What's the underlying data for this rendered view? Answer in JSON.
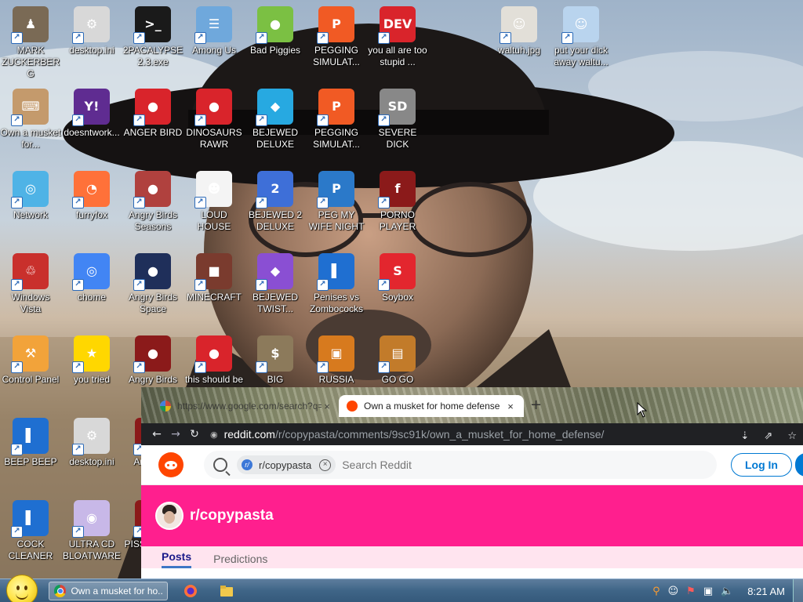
{
  "desktop": {
    "icons": [
      {
        "label": "MARK ZUCKERBERG",
        "color": "#7a6a55",
        "glyph": "♟"
      },
      {
        "label": "desktop.ini",
        "color": "#d8d8d8",
        "glyph": "⚙"
      },
      {
        "label": "2PACALYPSE 2.3.exe",
        "color": "#1a1a1a",
        "glyph": ">_"
      },
      {
        "label": "Among Us",
        "color": "#6fa8dc",
        "glyph": "☰"
      },
      {
        "label": "Bad Piggies",
        "color": "#7bc043",
        "glyph": "●"
      },
      {
        "label": "PEGGING SIMULAT...",
        "color": "#f15a24",
        "glyph": "P"
      },
      {
        "label": "you all are too stupid ...",
        "color": "#d9242b",
        "glyph": "DEV"
      },
      {
        "label": "waltuh.jpg",
        "color": "#e2dfd8",
        "glyph": "☺"
      },
      {
        "label": "put your dick away waltu...",
        "color": "#b9d4ee",
        "glyph": "☺"
      },
      {
        "label": "Own a musket for...",
        "color": "#c49a6c",
        "glyph": "⌨"
      },
      {
        "label": "doesntwork...",
        "color": "#5f2c91",
        "glyph": "Y!"
      },
      {
        "label": "ANGER BIRD",
        "color": "#d9242b",
        "glyph": "●"
      },
      {
        "label": "DINOSAURS RAWR",
        "color": "#d9242b",
        "glyph": "●"
      },
      {
        "label": "BEJEWED DELUXE",
        "color": "#27a9e1",
        "glyph": "◆"
      },
      {
        "label": "PEGGING SIMULAT...",
        "color": "#f15a24",
        "glyph": "P"
      },
      {
        "label": "SEVERE DICK",
        "color": "#888888",
        "glyph": "SD"
      },
      {
        "label": "Network",
        "color": "#4fb3e6",
        "glyph": "◎"
      },
      {
        "label": "furryfox",
        "color": "#ff7139",
        "glyph": "◔"
      },
      {
        "label": "Angry Birds Seasons",
        "color": "#b0413e",
        "glyph": "●"
      },
      {
        "label": "LOUD HOUSE",
        "color": "#f4f4f4",
        "glyph": "☻"
      },
      {
        "label": "BEJEWED 2 DELUXE",
        "color": "#3e6fd8",
        "glyph": "2"
      },
      {
        "label": "PEG MY WIFE NIGHT",
        "color": "#2b79c9",
        "glyph": "P"
      },
      {
        "label": "PORNO PLAYER",
        "color": "#8b1a1a",
        "glyph": "f"
      },
      {
        "label": "Windows Vista",
        "color": "#c9302c",
        "glyph": "♲"
      },
      {
        "label": "chome",
        "color": "#4285f4",
        "glyph": "◎"
      },
      {
        "label": "Angry Birds Space",
        "color": "#1f2f5a",
        "glyph": "●"
      },
      {
        "label": "MINECRAFT",
        "color": "#7a3b2e",
        "glyph": "■"
      },
      {
        "label": "BEJEWED TWIST...",
        "color": "#8a4fd3",
        "glyph": "◆"
      },
      {
        "label": "Penises vs Zombococks",
        "color": "#1f6fd1",
        "glyph": "▌"
      },
      {
        "label": "Soybox",
        "color": "#e3262e",
        "glyph": "S"
      },
      {
        "label": "Control Panel",
        "color": "#f2a33a",
        "glyph": "⚒"
      },
      {
        "label": "you tried",
        "color": "#ffd700",
        "glyph": "★"
      },
      {
        "label": "Angry Birds Sta...",
        "color": "#8b1a1a",
        "glyph": "●"
      },
      {
        "label": "this should be",
        "color": "#d9242b",
        "glyph": "●"
      },
      {
        "label": "BIG",
        "color": "#8c7a5b",
        "glyph": "$"
      },
      {
        "label": "RUSSIA",
        "color": "#d77a1e",
        "glyph": "▣"
      },
      {
        "label": "GO GO",
        "color": "#c27b2a",
        "glyph": "▤"
      },
      {
        "label": "BEEP BEEP",
        "color": "#1f6fd1",
        "glyph": "▌"
      },
      {
        "label": "desktop.ini",
        "color": "#d8d8d8",
        "glyph": "⚙"
      },
      {
        "label": "An... St...",
        "color": "#8b1a1a",
        "glyph": "●"
      },
      {
        "label": "COCK CLEANER",
        "color": "#1f6fd1",
        "glyph": "▌"
      },
      {
        "label": "ULTRA CD BLOATWARE",
        "color": "#c8b8e8",
        "glyph": "◉"
      },
      {
        "label": "PISS... IN V...",
        "color": "#8b1a1a",
        "glyph": "●"
      }
    ]
  },
  "browser": {
    "tabs": [
      {
        "title": "https://www.google.com/search?q=...",
        "favicon_color": "#888888",
        "close": "×"
      },
      {
        "title": "Own a musket for home defense",
        "favicon_color": "#ff4500",
        "close": "×"
      }
    ],
    "new_tab": "+",
    "nav": {
      "back": "←",
      "forward": "→",
      "reload": "↻"
    },
    "url": {
      "host": "reddit.com",
      "path": "/r/copypasta/comments/9sc91k/own_a_musket_for_home_defense/"
    },
    "page": {
      "search_chip": "r/copypasta",
      "search_chip_icon": "r/",
      "search_placeholder": "Search Reddit",
      "login_label": "Log In",
      "subreddit_name": "r/copypasta",
      "banner_color": "#ff1f8e",
      "tabs": [
        "Posts",
        "Predictions"
      ]
    }
  },
  "taskbar": {
    "active_window_title": "Own a musket for ho...",
    "clock": "8:21 AM"
  }
}
